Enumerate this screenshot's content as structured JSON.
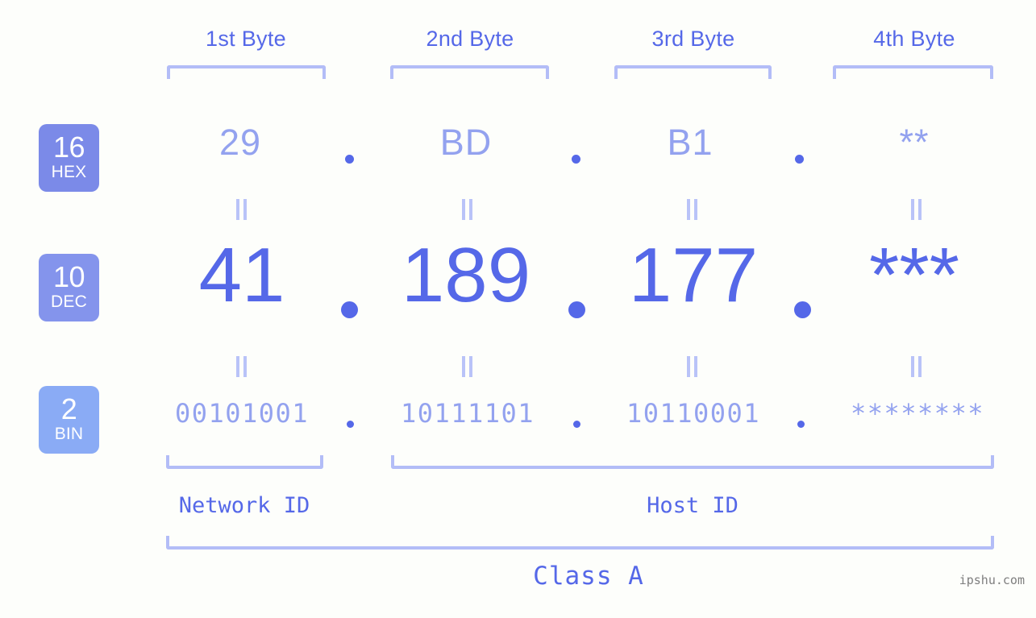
{
  "page": {
    "background_color": "#fdfefb",
    "accent_color": "#5568e8",
    "muted_accent_color": "#93a2ef",
    "bracket_color": "#b3bdf7",
    "watermark": "ipshu.com"
  },
  "header": {
    "byte_labels": [
      "1st Byte",
      "2nd Byte",
      "3rd Byte",
      "4th Byte"
    ]
  },
  "radix_badges": [
    {
      "number": "16",
      "name": "HEX",
      "color": "#7b8ae8"
    },
    {
      "number": "10",
      "name": "DEC",
      "color": "#8494ec"
    },
    {
      "number": "2",
      "name": "BIN",
      "color": "#8aabf5"
    }
  ],
  "rows": {
    "hex": {
      "label": "HEX",
      "octets": [
        "29",
        "BD",
        "B1",
        "**"
      ],
      "separator": "."
    },
    "dec": {
      "label": "DEC",
      "octets": [
        "41",
        "189",
        "177",
        "***"
      ],
      "separator": "."
    },
    "bin": {
      "label": "BIN",
      "octets": [
        "00101001",
        "10111101",
        "10110001",
        "********"
      ],
      "separator": "."
    }
  },
  "equality_marks": {
    "glyph": "=",
    "count_per_gap": 4,
    "gaps": [
      "hex-to-dec",
      "dec-to-bin"
    ]
  },
  "footer": {
    "network_id_label": "Network ID",
    "host_id_label": "Host ID",
    "class_label": "Class A"
  }
}
